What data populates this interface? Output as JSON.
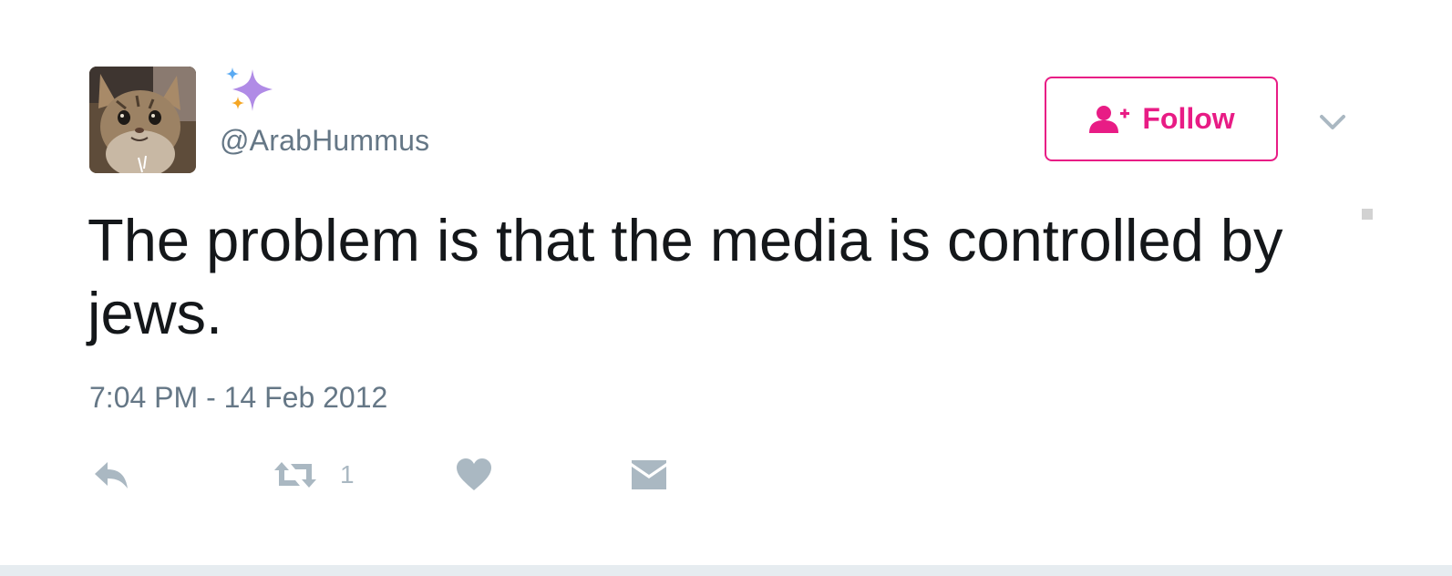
{
  "tweet": {
    "handle": "@ArabHummus",
    "text": "The problem is that the media is controlled by jews.",
    "timestamp": "7:04 PM - 14 Feb 2012"
  },
  "follow_button": {
    "label": "Follow",
    "icon": "person-add-icon"
  },
  "menu": {
    "icon": "chevron-down-icon"
  },
  "actions": {
    "reply": {
      "icon": "reply-icon"
    },
    "retweet": {
      "icon": "retweet-icon",
      "count": "1"
    },
    "like": {
      "icon": "heart-icon"
    },
    "message": {
      "icon": "envelope-icon"
    }
  },
  "colors": {
    "accent": "#e81c85",
    "text": "#14171a",
    "muted": "#657786",
    "icon": "#aab8c2",
    "sparkle_purple": "#b08be6",
    "sparkle_blue": "#5aaaf2",
    "sparkle_orange": "#f5a623"
  }
}
